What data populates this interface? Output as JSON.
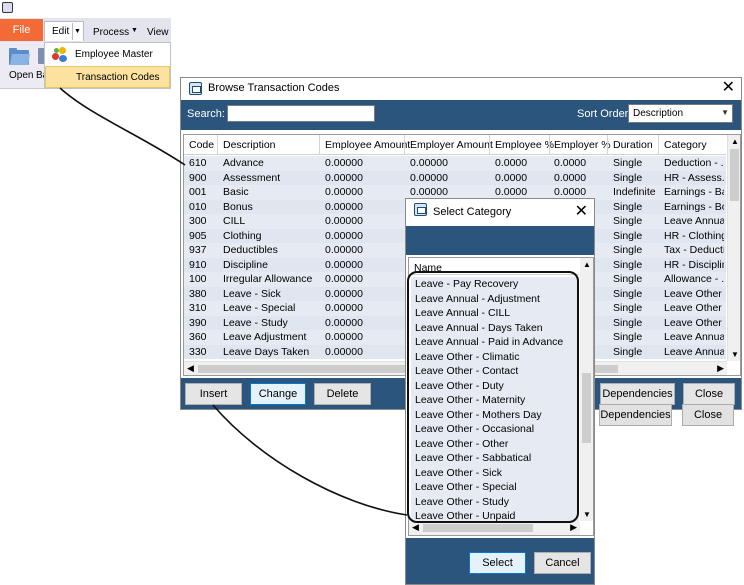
{
  "ribbon": {
    "tabs": {
      "file": "File",
      "edit": "Edit",
      "process": "Process",
      "view": "View"
    },
    "buttons": {
      "open": "Open",
      "ba": "Ba"
    },
    "menu": [
      {
        "label": "Employee Master",
        "icon": "employee-master-icon"
      },
      {
        "label": "Transaction Codes",
        "highlighted": true
      }
    ]
  },
  "browse": {
    "title": "Browse Transaction Codes",
    "search_label": "Search:",
    "search_value": "",
    "sort_label": "Sort Order",
    "sort_value": "Description",
    "columns": [
      "Code",
      "Description",
      "Employee Amount",
      "Employer Amount",
      "Employee %",
      "Employer %",
      "Duration",
      "Category"
    ],
    "rows": [
      [
        "610",
        "Advance",
        "0.00000",
        "0.00000",
        "0.0000",
        "0.0000",
        "Single",
        "Deduction - ..."
      ],
      [
        "900",
        "Assessment",
        "0.00000",
        "0.00000",
        "0.0000",
        "0.0000",
        "Single",
        "HR - Assess..."
      ],
      [
        "001",
        "Basic",
        "0.00000",
        "0.00000",
        "0.0000",
        "0.0000",
        "Indefinite",
        "Earnings - Ba..."
      ],
      [
        "010",
        "Bonus",
        "0.00000",
        "0.00000",
        "0.0000",
        "0.0000",
        "Single",
        "Earnings - Bo..."
      ],
      [
        "300",
        "CILL",
        "0.00000",
        "",
        "",
        "",
        "Single",
        "Leave Annua..."
      ],
      [
        "905",
        "Clothing",
        "0.00000",
        "",
        "",
        "",
        "Single",
        "HR - Clothing"
      ],
      [
        "937",
        "Deductibles",
        "0.00000",
        "",
        "",
        "",
        "Single",
        "Tax - Deducti..."
      ],
      [
        "910",
        "Discipline",
        "0.00000",
        "",
        "",
        "",
        "Single",
        "HR - Discipline"
      ],
      [
        "100",
        "Irregular Allowance",
        "0.00000",
        "",
        "",
        "",
        "Single",
        "Allowance - ..."
      ],
      [
        "380",
        "Leave - Sick",
        "0.00000",
        "",
        "",
        "",
        "Single",
        "Leave Other - ..."
      ],
      [
        "310",
        "Leave - Special",
        "0.00000",
        "",
        "",
        "",
        "Single",
        "Leave Other - ..."
      ],
      [
        "390",
        "Leave - Study",
        "0.00000",
        "",
        "",
        "",
        "Single",
        "Leave Other - ..."
      ],
      [
        "360",
        "Leave Adjustment",
        "0.00000",
        "",
        "",
        "",
        "Single",
        "Leave Annua..."
      ],
      [
        "330",
        "Leave Days Taken",
        "0.00000",
        "",
        "",
        "",
        "Single",
        "Leave Annua..."
      ]
    ],
    "buttons": {
      "insert": "Insert",
      "change": "Change",
      "delete": "Delete",
      "dependencies": "Dependencies",
      "close": "Close"
    }
  },
  "select_category": {
    "title": "Select Category",
    "column": "Name",
    "items": [
      "Leave - Pay Recovery",
      "Leave Annual - Adjustment",
      "Leave Annual - CILL",
      "Leave Annual - Days Taken",
      "Leave Annual - Paid in Advance",
      "Leave Other - Climatic",
      "Leave Other - Contact",
      "Leave Other - Duty",
      "Leave Other - Maternity",
      "Leave Other - Mothers Day",
      "Leave Other - Occasional",
      "Leave Other - Other",
      "Leave Other - Sabbatical",
      "Leave Other - Sick",
      "Leave Other - Special",
      "Leave Other - Study",
      "Leave Other - Unpaid"
    ],
    "buttons": {
      "select": "Select",
      "cancel": "Cancel"
    }
  },
  "colors": {
    "accent_bar": "#2b557c",
    "file_tab": "#f26a36",
    "menu_highlight": "#fbe29f",
    "row": "#e6ebf3"
  }
}
